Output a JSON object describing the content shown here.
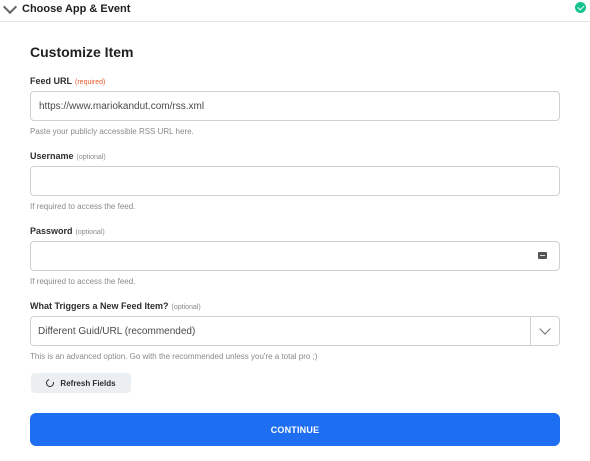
{
  "header": {
    "title": "Choose App & Event",
    "expand_icon": "chevron-down-icon",
    "status_icon": "check-circle-icon",
    "status_color": "#14c38e"
  },
  "section": {
    "title": "Customize Item"
  },
  "fields": {
    "feed_url": {
      "label": "Feed URL",
      "badge": "(required)",
      "value": "https://www.mariokandut.com/rss.xml",
      "help": "Paste your publicly accessible RSS URL here."
    },
    "username": {
      "label": "Username",
      "badge": "(optional)",
      "value": "",
      "help": "If required to access the feed."
    },
    "password": {
      "label": "Password",
      "badge": "(optional)",
      "value": "",
      "help": "If required to access the feed.",
      "icon": "password-manager-icon"
    },
    "trigger": {
      "label": "What Triggers a New Feed Item?",
      "badge": "(optional)",
      "selected": "Different Guid/URL (recommended)",
      "help": "This is an advanced option. Go with the recommended unless you're a total pro ;)"
    }
  },
  "buttons": {
    "refresh_label": "Refresh Fields",
    "refresh_icon": "refresh-icon",
    "continue_label": "CONTINUE",
    "continue_color": "#1e6ef2"
  }
}
